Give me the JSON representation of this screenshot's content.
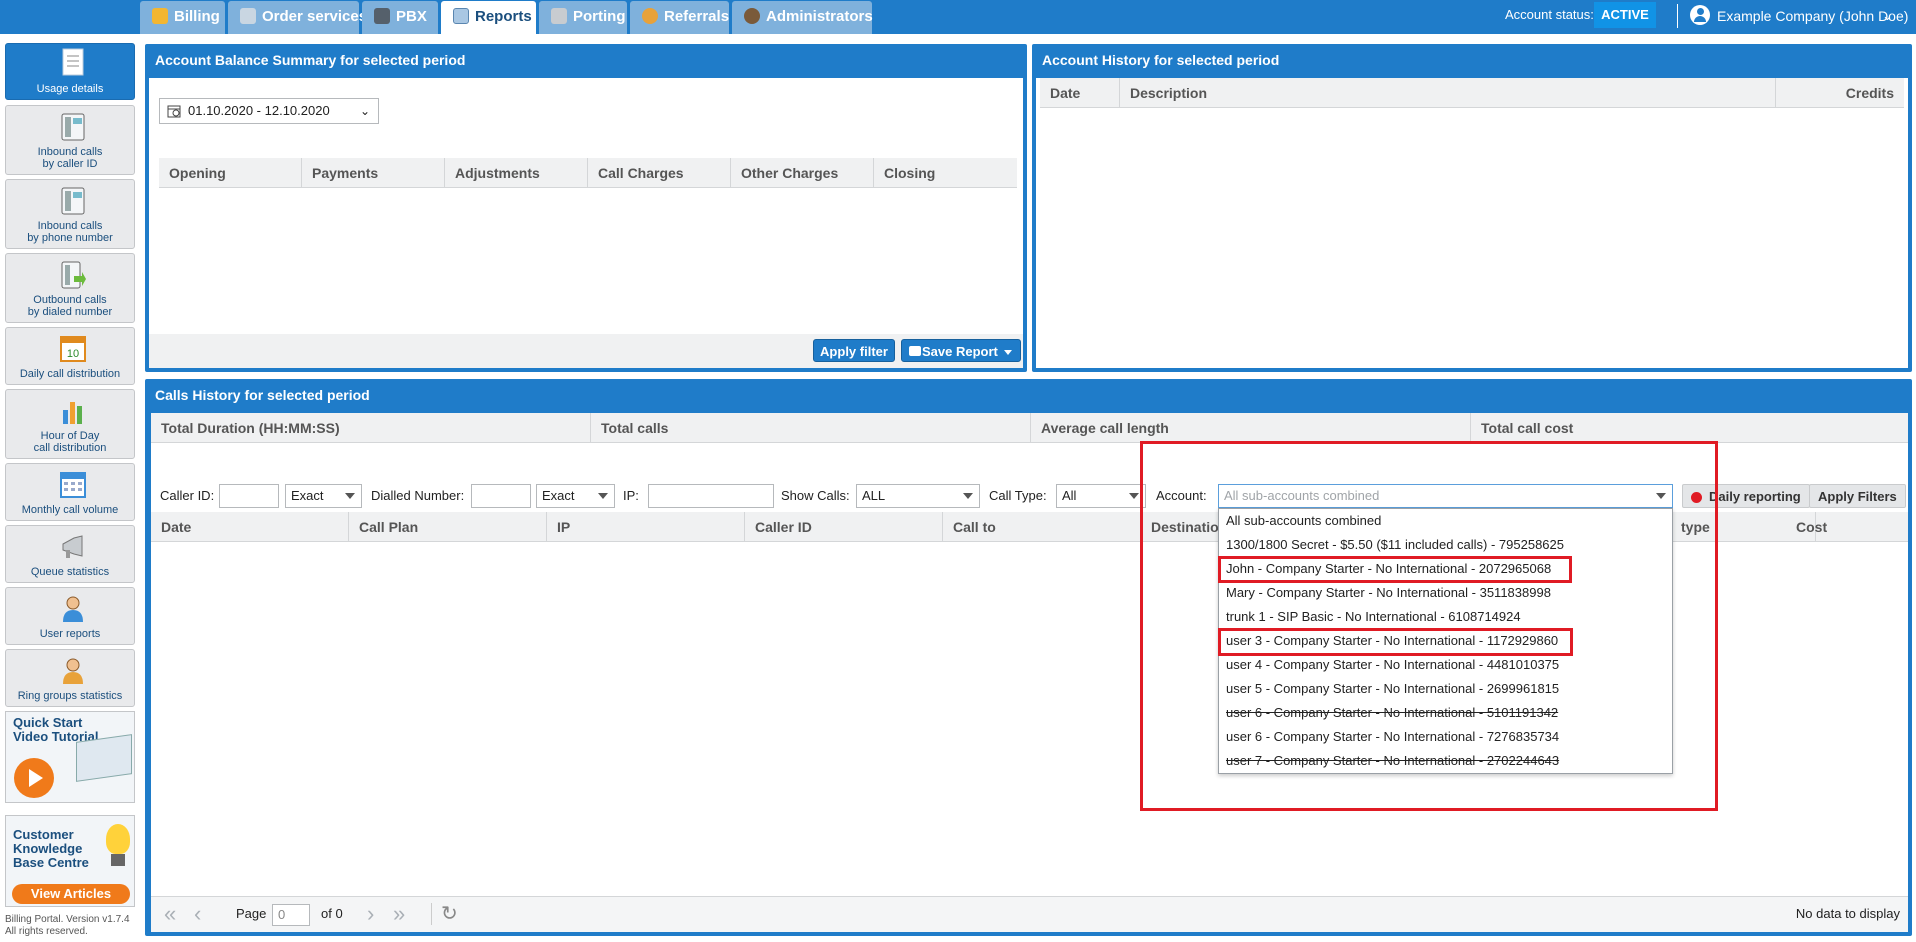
{
  "nav": {
    "tabs": [
      {
        "label": "Billing",
        "icon": "coins-icon"
      },
      {
        "label": "Order services",
        "icon": "cart-icon"
      },
      {
        "label": "PBX",
        "icon": "pbx-icon"
      },
      {
        "label": "Reports",
        "icon": "report-icon"
      },
      {
        "label": "Porting",
        "icon": "phone-icon"
      },
      {
        "label": "Referrals",
        "icon": "person-icon"
      },
      {
        "label": "Administrators",
        "icon": "admin-icon"
      }
    ],
    "active_tab": "Reports",
    "account_status_label": "Account status:",
    "account_status_value": "ACTIVE",
    "user_name": "Example Company (John Doe)"
  },
  "sidebar": {
    "items": [
      {
        "label": "Usage details"
      },
      {
        "label": "Inbound calls\nby caller ID"
      },
      {
        "label": "Inbound calls\nby phone number"
      },
      {
        "label": "Outbound calls\nby dialed number"
      },
      {
        "label": "Daily call distribution"
      },
      {
        "label": "Hour of Day\ncall distribution"
      },
      {
        "label": "Monthly call volume"
      },
      {
        "label": "Queue statistics"
      },
      {
        "label": "User reports"
      },
      {
        "label": "Ring groups statistics"
      }
    ],
    "promo_video": {
      "line1": "Quick Start",
      "line2": "Video Tutorial"
    },
    "promo_kb": {
      "line1": "Customer",
      "line2": "Knowledge",
      "line3": "Base Centre",
      "button": "View Articles"
    },
    "footer_line1": "Billing Portal. Version v1.7.4",
    "footer_line2": "All rights reserved."
  },
  "balance_panel": {
    "title": "Account Balance Summary for selected period",
    "date_range": "01.10.2020 - 12.10.2020",
    "columns": [
      "Opening",
      "Payments",
      "Adjustments",
      "Call Charges",
      "Other Charges",
      "Closing"
    ],
    "apply_filter": "Apply filter",
    "save_report": "Save Report"
  },
  "history_panel": {
    "title": "Account History for selected period",
    "columns": [
      "Date",
      "Description",
      "Credits"
    ]
  },
  "calls_panel": {
    "title": "Calls History for selected period",
    "summary_columns": [
      "Total Duration (HH:MM:SS)",
      "Total calls",
      "Average call length",
      "Total call cost"
    ],
    "filters": {
      "caller_id_label": "Caller ID:",
      "caller_id_value": "",
      "caller_id_match": "Exact",
      "dialled_label": "Dialled Number:",
      "dialled_value": "",
      "dialled_match": "Exact",
      "ip_label": "IP:",
      "ip_value": "",
      "show_calls_label": "Show Calls:",
      "show_calls_value": "ALL",
      "call_type_label": "Call Type:",
      "call_type_value": "All",
      "account_label": "Account:",
      "account_placeholder": "All sub-accounts combined",
      "daily_reporting": "Daily reporting",
      "apply_filters": "Apply Filters"
    },
    "columns": [
      "Date",
      "Call Plan",
      "IP",
      "Caller ID",
      "Call to",
      "Destination",
      "type",
      "Cost"
    ],
    "account_options": [
      {
        "label": "All sub-accounts combined",
        "strike": false
      },
      {
        "label": "1300/1800 Secret - $5.50 ($11 included calls) - 795258625",
        "strike": false
      },
      {
        "label": "John - Company Starter - No International - 2072965068",
        "strike": false
      },
      {
        "label": "Mary - Company Starter - No International - 3511838998",
        "strike": false
      },
      {
        "label": "trunk 1 - SIP Basic - No International - 6108714924",
        "strike": false
      },
      {
        "label": "user 3 - Company Starter - No International - 1172929860",
        "strike": false
      },
      {
        "label": "user 4 - Company Starter - No International - 4481010375",
        "strike": false
      },
      {
        "label": "user 5 - Company Starter - No International - 2699961815",
        "strike": false
      },
      {
        "label": "user 6 - Company Starter - No International - 5101191342",
        "strike": true
      },
      {
        "label": "user 6 - Company Starter - No International - 7276835734",
        "strike": false
      },
      {
        "label": "user 7 - Company Starter - No International - 2702244643",
        "strike": true
      }
    ],
    "pager": {
      "page_label": "Page",
      "page_value": "0",
      "of_label": "of 0",
      "no_data": "No data to display"
    }
  },
  "colors": {
    "brand_blue": "#1f7cc9",
    "highlight_red": "#e01b24"
  }
}
